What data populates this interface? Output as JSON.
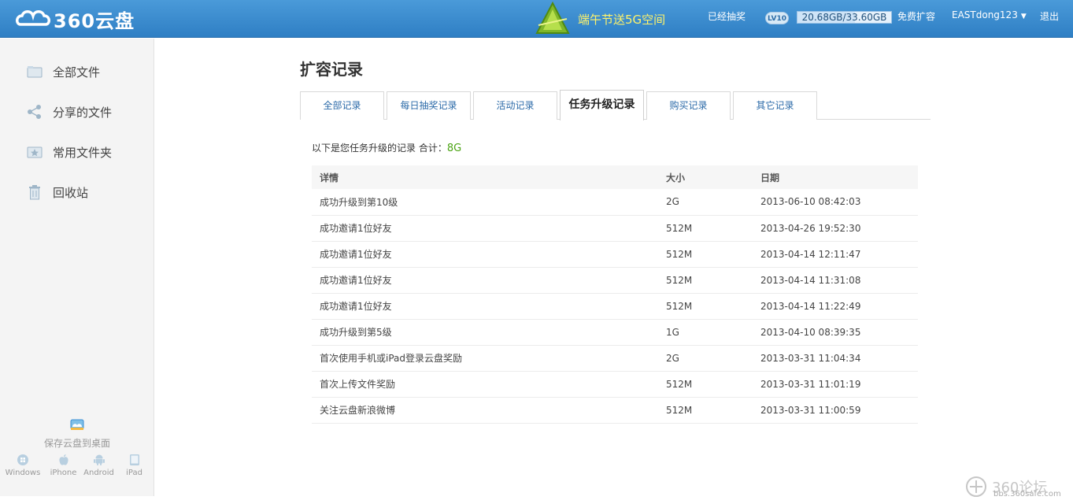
{
  "header": {
    "logo_text": "360云盘",
    "promo": "端午节送5G空间",
    "lottery_done": "已经抽奖",
    "level_badge": "LV10",
    "quota_text": "20.68GB/33.60GB",
    "quota_used_fraction": 0.615,
    "free_expand": "免费扩容",
    "username": "EASTdong123",
    "logout": "退出"
  },
  "sidebar": {
    "items": [
      {
        "label": "全部文件",
        "icon": "folder-icon"
      },
      {
        "label": "分享的文件",
        "icon": "share-icon"
      },
      {
        "label": "常用文件夹",
        "icon": "star-folder-icon"
      },
      {
        "label": "回收站",
        "icon": "trash-icon"
      }
    ],
    "save_to_desktop": "保存云盘到桌面",
    "platforms": [
      "Windows",
      "iPhone",
      "Android",
      "iPad"
    ]
  },
  "main": {
    "title": "扩容记录",
    "tabs": [
      "全部记录",
      "每日抽奖记录",
      "活动记录",
      "任务升级记录",
      "购买记录",
      "其它记录"
    ],
    "active_tab": "任务升级记录",
    "summary_prefix": "以下是您任务升级的记录  合计：",
    "summary_total": "8G",
    "table": {
      "headers": [
        "详情",
        "大小",
        "日期"
      ],
      "rows": [
        [
          "成功升级到第10级",
          "2G",
          "2013-06-10 08:42:03"
        ],
        [
          "成功邀请1位好友",
          "512M",
          "2013-04-26 19:52:30"
        ],
        [
          "成功邀请1位好友",
          "512M",
          "2013-04-14 12:11:47"
        ],
        [
          "成功邀请1位好友",
          "512M",
          "2013-04-14 11:31:08"
        ],
        [
          "成功邀请1位好友",
          "512M",
          "2013-04-14 11:22:49"
        ],
        [
          "成功升级到第5级",
          "1G",
          "2013-04-10 08:39:35"
        ],
        [
          "首次使用手机或iPad登录云盘奖励",
          "2G",
          "2013-03-31 11:04:34"
        ],
        [
          "首次上传文件奖励",
          "512M",
          "2013-03-31 11:01:19"
        ],
        [
          "关注云盘新浪微博",
          "512M",
          "2013-03-31 11:00:59"
        ]
      ]
    }
  },
  "watermark": {
    "text": "360论坛",
    "sub": "bbs.360safe.com"
  },
  "colors": {
    "header": "#3a8ed3",
    "accent_link": "#2b6aa8",
    "total_green": "#4aa312",
    "promo_yellow": "#fff36a"
  }
}
